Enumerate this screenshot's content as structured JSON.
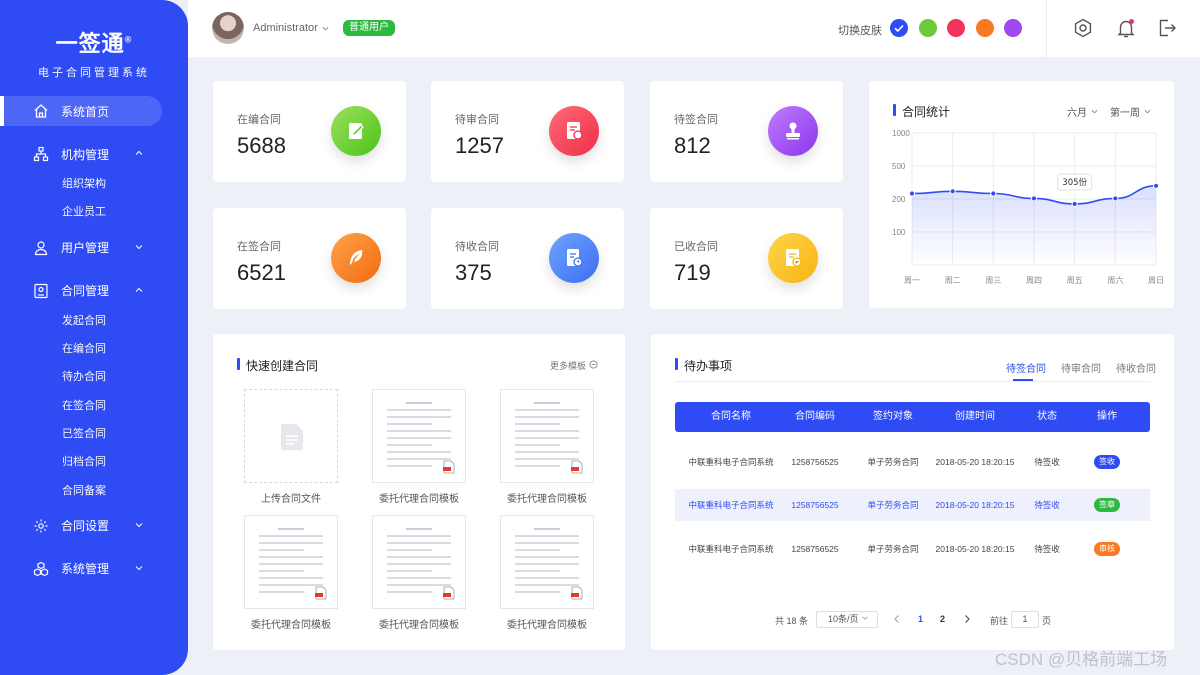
{
  "sidebar": {
    "logo_title": "一签通",
    "logo_mark": "®",
    "logo_sub": "电子合同管理系统",
    "items": [
      {
        "label": "系统首页",
        "icon": "home-icon",
        "active": true
      },
      {
        "label": "机构管理",
        "icon": "org-chart-icon",
        "expanded": true,
        "children": [
          "组织架构",
          "企业员工"
        ]
      },
      {
        "label": "用户管理",
        "icon": "user-icon",
        "expanded": false
      },
      {
        "label": "合同管理",
        "icon": "contract-icon",
        "expanded": true,
        "children": [
          "发起合同",
          "在编合同",
          "待办合同",
          "在签合同",
          "已签合同",
          "归档合同",
          "合同备案"
        ]
      },
      {
        "label": "合同设置",
        "icon": "gear-icon",
        "expanded": false
      },
      {
        "label": "系统管理",
        "icon": "cubes-icon",
        "expanded": false
      }
    ]
  },
  "header": {
    "username": "Administrator",
    "role_badge": "普通用户",
    "skin_label": "切换皮肤",
    "skin_colors": [
      "#2f4cf4",
      "#6cc93a",
      "#f2345c",
      "#f97a22",
      "#a148f0"
    ],
    "accent": "#2f4cf4"
  },
  "stats": [
    {
      "label": "在编合同",
      "value": "5688",
      "icon": "edit-icon",
      "color_from": "#9be15d",
      "color_to": "#4cc21a"
    },
    {
      "label": "待审合同",
      "value": "1257",
      "icon": "review-doc-icon",
      "color_from": "#ff6b76",
      "color_to": "#ef2e4a"
    },
    {
      "label": "待签合同",
      "value": "812",
      "icon": "stamp-icon",
      "color_from": "#c17cff",
      "color_to": "#8b36ea"
    },
    {
      "label": "在签合同",
      "value": "6521",
      "icon": "feather-pen-icon",
      "color_from": "#ffa24a",
      "color_to": "#f26b0f"
    },
    {
      "label": "待收合同",
      "value": "375",
      "icon": "doc-clock-icon",
      "color_from": "#6fa3ff",
      "color_to": "#3c6ff0"
    },
    {
      "label": "已收合同",
      "value": "719",
      "icon": "doc-check-icon",
      "color_from": "#ffd54a",
      "color_to": "#f6b312"
    }
  ],
  "chart_card": {
    "title": "合同统计",
    "select_month": "六月",
    "select_week": "第一周"
  },
  "chart_data": {
    "type": "line",
    "categories": [
      "周一",
      "周二",
      "周三",
      "周四",
      "周五",
      "周六",
      "周日"
    ],
    "values": [
      250,
      270,
      250,
      205,
      185,
      205,
      320
    ],
    "y_ticks": [
      1000,
      500,
      200,
      100
    ],
    "ylim": [
      0,
      1000
    ],
    "annotation": {
      "index": 4,
      "text": "305份"
    },
    "grid": true,
    "line_color": "#2f4cf4"
  },
  "quick_create": {
    "title": "快速创建合同",
    "more_label": "更多模板",
    "upload_label": "上传合同文件",
    "templates": [
      "委托代理合同模板",
      "委托代理合同模板",
      "委托代理合同模板",
      "委托代理合同模板",
      "委托代理合同模板"
    ]
  },
  "todo": {
    "title": "待办事项",
    "tabs": [
      "待签合同",
      "待审合同",
      "待收合同"
    ],
    "columns": [
      "合同名称",
      "合同编码",
      "签约对象",
      "创建时间",
      "状态",
      "操作"
    ],
    "rows": [
      {
        "name": "中联重科电子合同系统",
        "code": "1258756525",
        "party": "单子劳务合同",
        "time": "2018-05-20 18:20:15",
        "status": "待签收",
        "action": "签收",
        "action_color": "#2f4cf4"
      },
      {
        "name": "中联重科电子合同系统",
        "code": "1258756525",
        "party": "单子劳务合同",
        "time": "2018-05-20 18:20:15",
        "status": "待签收",
        "action": "签章",
        "action_color": "#2db842"
      },
      {
        "name": "中联重科电子合同系统",
        "code": "1258756525",
        "party": "单子劳务合同",
        "time": "2018-05-20 18:20:15",
        "status": "待签收",
        "action": "审核",
        "action_color": "#f97a22"
      }
    ],
    "pager": {
      "total": "共 18 条",
      "page_size": "10条/页",
      "pages": [
        "1",
        "2"
      ],
      "goto_label": "前往",
      "goto_value": "1",
      "goto_unit": "页"
    }
  },
  "watermark": "CSDN @贝格前端工场"
}
